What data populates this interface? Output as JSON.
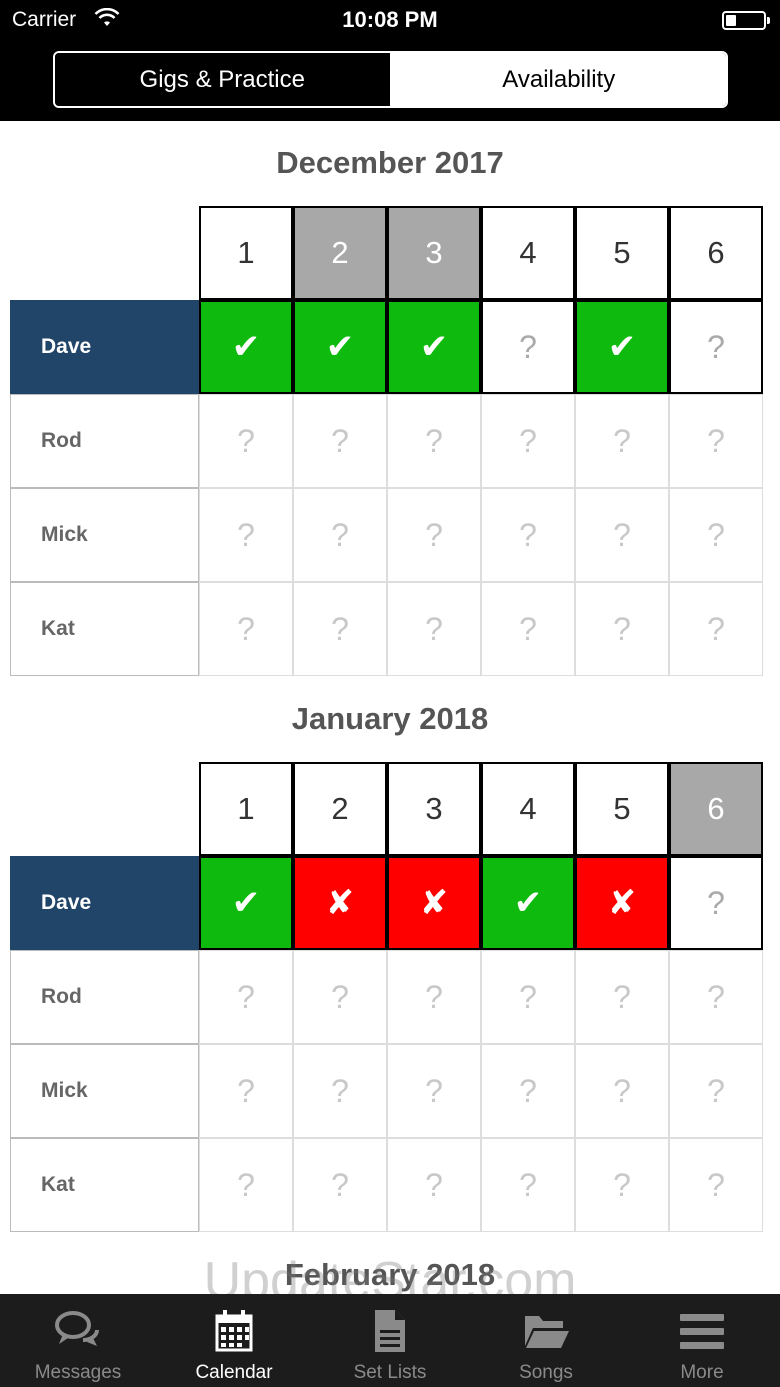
{
  "status_bar": {
    "carrier": "Carrier",
    "time": "10:08 PM"
  },
  "segmented": {
    "left_label": "Gigs & Practice",
    "right_label": "Availability"
  },
  "months": [
    {
      "title": "December 2017",
      "days": [
        "1",
        "2",
        "3",
        "4",
        "5",
        "6"
      ],
      "past_days": [
        false,
        true,
        true,
        false,
        false,
        false
      ],
      "members": [
        {
          "name": "Dave",
          "statuses": [
            "yes",
            "yes",
            "yes",
            "unknown",
            "yes",
            "unknown"
          ]
        },
        {
          "name": "Rod",
          "statuses": [
            "unknown",
            "unknown",
            "unknown",
            "unknown",
            "unknown",
            "unknown"
          ]
        },
        {
          "name": "Mick",
          "statuses": [
            "unknown",
            "unknown",
            "unknown",
            "unknown",
            "unknown",
            "unknown"
          ]
        },
        {
          "name": "Kat",
          "statuses": [
            "unknown",
            "unknown",
            "unknown",
            "unknown",
            "unknown",
            "unknown"
          ]
        }
      ]
    },
    {
      "title": "January 2018",
      "days": [
        "1",
        "2",
        "3",
        "4",
        "5",
        "6"
      ],
      "past_days": [
        false,
        false,
        false,
        false,
        false,
        true
      ],
      "members": [
        {
          "name": "Dave",
          "statuses": [
            "yes",
            "no",
            "no",
            "yes",
            "no",
            "unknown"
          ]
        },
        {
          "name": "Rod",
          "statuses": [
            "unknown",
            "unknown",
            "unknown",
            "unknown",
            "unknown",
            "unknown"
          ]
        },
        {
          "name": "Mick",
          "statuses": [
            "unknown",
            "unknown",
            "unknown",
            "unknown",
            "unknown",
            "unknown"
          ]
        },
        {
          "name": "Kat",
          "statuses": [
            "unknown",
            "unknown",
            "unknown",
            "unknown",
            "unknown",
            "unknown"
          ]
        }
      ]
    }
  ],
  "next_month_title": "February 2018",
  "watermark": "UpdateStar.com",
  "status_symbols": {
    "yes": "✔",
    "no": "✘",
    "unknown": "?"
  },
  "tabs": [
    {
      "label": "Messages",
      "icon": "chat-bubbles-icon",
      "active": false
    },
    {
      "label": "Calendar",
      "icon": "calendar-icon",
      "active": true
    },
    {
      "label": "Set Lists",
      "icon": "document-icon",
      "active": false
    },
    {
      "label": "Songs",
      "icon": "folder-icon",
      "active": false
    },
    {
      "label": "More",
      "icon": "menu-icon",
      "active": false
    }
  ],
  "colors": {
    "header_bg": "#000000",
    "me_row_bg": "#214469",
    "available": "#0dba0d",
    "unavailable": "#ff0000",
    "past_day": "#a8a8a8",
    "tabbar_bg": "#1c1c1c"
  }
}
